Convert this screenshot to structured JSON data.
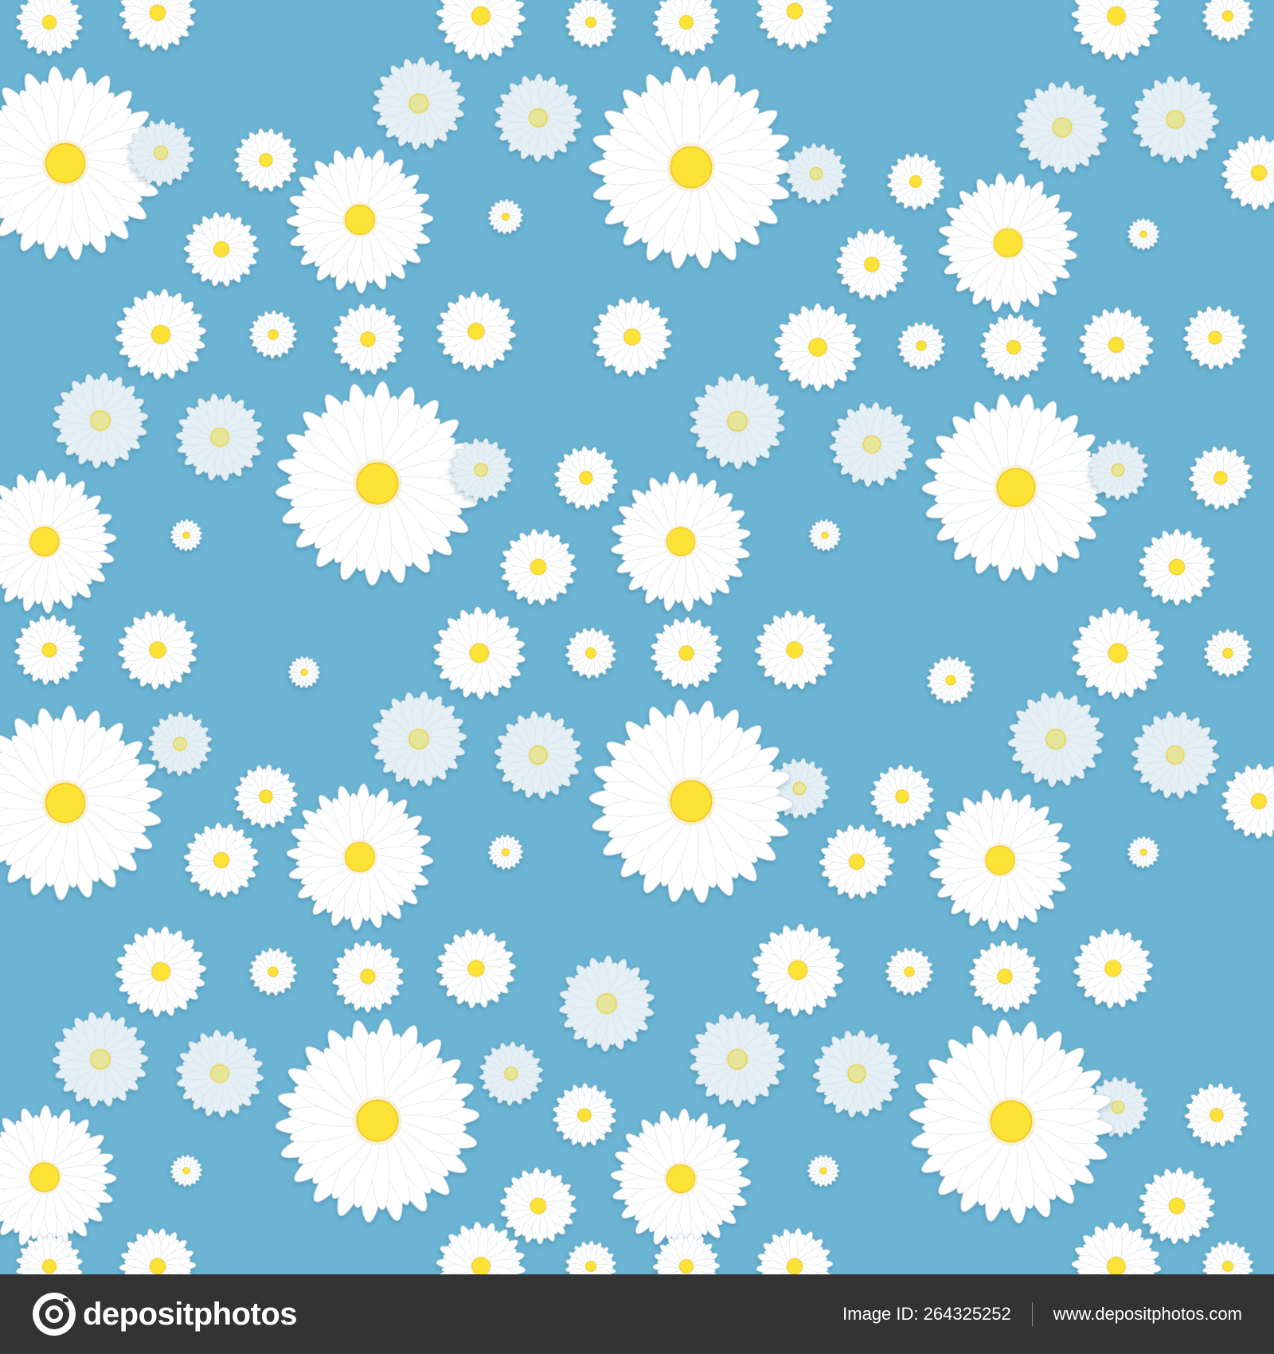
{
  "colors": {
    "background": "#6cb4d3",
    "footer": "#333333",
    "petal": "#ffffff",
    "petal_faded": "#e4f0f6",
    "center": "#fde336",
    "center_edge": "#f3c92a"
  },
  "pattern": {
    "subject": "white daisy flowers with yellow centres on a sky-blue background",
    "repeat": "seamless tile"
  },
  "footer": {
    "logo_text": "depositphotos",
    "image_id_label": "Image ID:",
    "image_id": "264325252",
    "site_url": "www.depositphotos.com"
  }
}
